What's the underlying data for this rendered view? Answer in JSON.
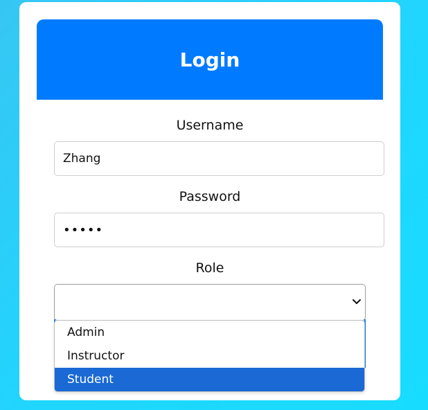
{
  "header": {
    "title": "Login"
  },
  "form": {
    "username_label": "Username",
    "username_value": "Zhang",
    "password_label": "Password",
    "password_value": "•••••",
    "role_label": "Role",
    "role_value": ""
  },
  "dropdown": {
    "options": [
      "Admin",
      "Instructor",
      "Student"
    ],
    "highlighted": "Student"
  },
  "colors": {
    "accent": "#007bff",
    "background": "#1fd6ff",
    "selected_option": "#1a69d4"
  },
  "icons": {
    "select_arrow": "chevron-down-icon"
  }
}
